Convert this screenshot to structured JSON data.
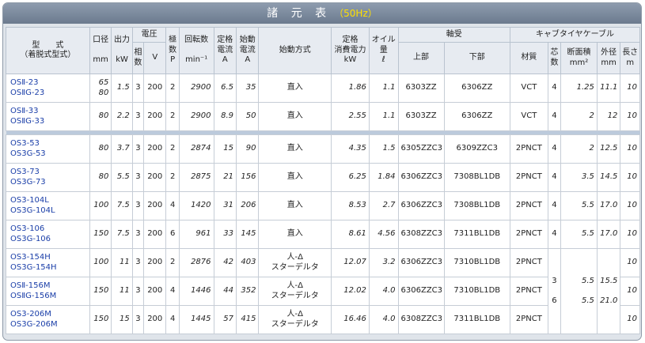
{
  "title": {
    "main": "諸 元 表",
    "hz": "（50Hz）"
  },
  "headers": {
    "model": [
      "型　　式",
      "（着脱式型式）"
    ],
    "bore": [
      "口径",
      "mm"
    ],
    "output": [
      "出力",
      "kW"
    ],
    "voltage_group": "電圧",
    "phase": [
      "相",
      "数"
    ],
    "volt": "V",
    "poles": [
      "極",
      "数",
      "P"
    ],
    "rpm": [
      "回転数",
      "min⁻¹"
    ],
    "rated_current": [
      "定格",
      "電流",
      "A"
    ],
    "start_current": [
      "始動",
      "電流",
      "A"
    ],
    "start_method": "始動方式",
    "power": [
      "定格",
      "消費電力",
      "kW"
    ],
    "oil": [
      "オイル",
      "量",
      "ℓ"
    ],
    "bearing_group": "軸受",
    "bearing_upper": "上部",
    "bearing_lower": "下部",
    "cable_group": "キャブタイヤケーブル",
    "material": "材質",
    "cores": [
      "芯",
      "数"
    ],
    "area": [
      "断面積",
      "mm²"
    ],
    "outer": [
      "外径",
      "mm"
    ],
    "length": [
      "長さ",
      "m"
    ]
  },
  "rows_group1": [
    {
      "model": [
        "OSⅡ-23",
        "OSⅡG-23"
      ],
      "bore": "65\n80",
      "out": "1.5",
      "ph": "3",
      "v": "200",
      "p": "2",
      "rpm": "2900",
      "rc": "6.5",
      "sc": "35",
      "method": "直入",
      "pw": "1.86",
      "oil": "1.1",
      "bu": "6303ZZ",
      "bl": "6306ZZ",
      "mat": "VCT",
      "core": "4",
      "area": "1.25",
      "od": "11.1",
      "len": "10"
    },
    {
      "model": [
        "OSⅡ-33",
        "OSⅡG-33"
      ],
      "bore": "80",
      "out": "2.2",
      "ph": "3",
      "v": "200",
      "p": "2",
      "rpm": "2900",
      "rc": "8.9",
      "sc": "50",
      "method": "直入",
      "pw": "2.55",
      "oil": "1.1",
      "bu": "6303ZZ",
      "bl": "6306ZZ",
      "mat": "VCT",
      "core": "4",
      "area": "2",
      "od": "12",
      "len": "10"
    }
  ],
  "rows_group2": [
    {
      "model": [
        "OS3-53",
        "OS3G-53"
      ],
      "bore": "80",
      "out": "3.7",
      "ph": "3",
      "v": "200",
      "p": "2",
      "rpm": "2874",
      "rc": "15",
      "sc": "90",
      "method": "直入",
      "pw": "4.35",
      "oil": "1.5",
      "bu": "6305ZZC3",
      "bl": "6309ZZC3",
      "mat": "2PNCT",
      "core": "4",
      "area": "2",
      "od": "12.5",
      "len": "10"
    },
    {
      "model": [
        "OS3-73",
        "OS3G-73"
      ],
      "bore": "80",
      "out": "5.5",
      "ph": "3",
      "v": "200",
      "p": "2",
      "rpm": "2875",
      "rc": "21",
      "sc": "156",
      "method": "直入",
      "pw": "6.25",
      "oil": "1.84",
      "bu": "6306ZZC3",
      "bl": "7308BL1DB",
      "mat": "2PNCT",
      "core": "4",
      "area": "3.5",
      "od": "14.5",
      "len": "10"
    },
    {
      "model": [
        "OS3-104L",
        "OS3G-104L"
      ],
      "bore": "100",
      "out": "7.5",
      "ph": "3",
      "v": "200",
      "p": "4",
      "rpm": "1420",
      "rc": "31",
      "sc": "206",
      "method": "直入",
      "pw": "8.53",
      "oil": "2.7",
      "bu": "6306ZZC3",
      "bl": "7308BL1DB",
      "mat": "2PNCT",
      "core": "4",
      "area": "5.5",
      "od": "17.0",
      "len": "10"
    },
    {
      "model": [
        "OS3-106",
        "OS3G-106"
      ],
      "bore": "150",
      "out": "7.5",
      "ph": "3",
      "v": "200",
      "p": "6",
      "rpm": "961",
      "rc": "33",
      "sc": "145",
      "method": "直入",
      "pw": "8.61",
      "oil": "4.56",
      "bu": "6308ZZC3",
      "bl": "7311BL1DB",
      "mat": "2PNCT",
      "core": "4",
      "area": "5.5",
      "od": "17.0",
      "len": "10"
    },
    {
      "model": [
        "OS3-154H",
        "OS3G-154H"
      ],
      "bore": "100",
      "out": "11",
      "ph": "3",
      "v": "200",
      "p": "2",
      "rpm": "2876",
      "rc": "42",
      "sc": "403",
      "method": "人-Δ\nスターデルタ",
      "pw": "12.07",
      "oil": "3.2",
      "bu": "6306ZZC3",
      "bl": "7310BL1DB",
      "mat": "2PNCT",
      "len": "10"
    },
    {
      "model": [
        "OSⅡ-156M",
        "OSⅡG-156M"
      ],
      "bore": "150",
      "out": "11",
      "ph": "3",
      "v": "200",
      "p": "4",
      "rpm": "1446",
      "rc": "44",
      "sc": "352",
      "method": "人-Δ\nスターデルタ",
      "pw": "12.02",
      "oil": "4.0",
      "bu": "6306ZZC3",
      "bl": "7310BL1DB",
      "mat": "2PNCT",
      "len": "10"
    },
    {
      "model": [
        "OS3-206M",
        "OS3G-206M"
      ],
      "bore": "150",
      "out": "15",
      "ph": "3",
      "v": "200",
      "p": "4",
      "rpm": "1445",
      "rc": "57",
      "sc": "415",
      "method": "人-Δ\nスターデルタ",
      "pw": "16.46",
      "oil": "4.0",
      "bu": "6308ZZC3",
      "bl": "7311BL1DB",
      "mat": "2PNCT",
      "len": "10"
    }
  ],
  "merged_cable": {
    "cores": "3\n\n6",
    "area": "5.5\n\n5.5",
    "od": "15.5\n\n21.0"
  }
}
